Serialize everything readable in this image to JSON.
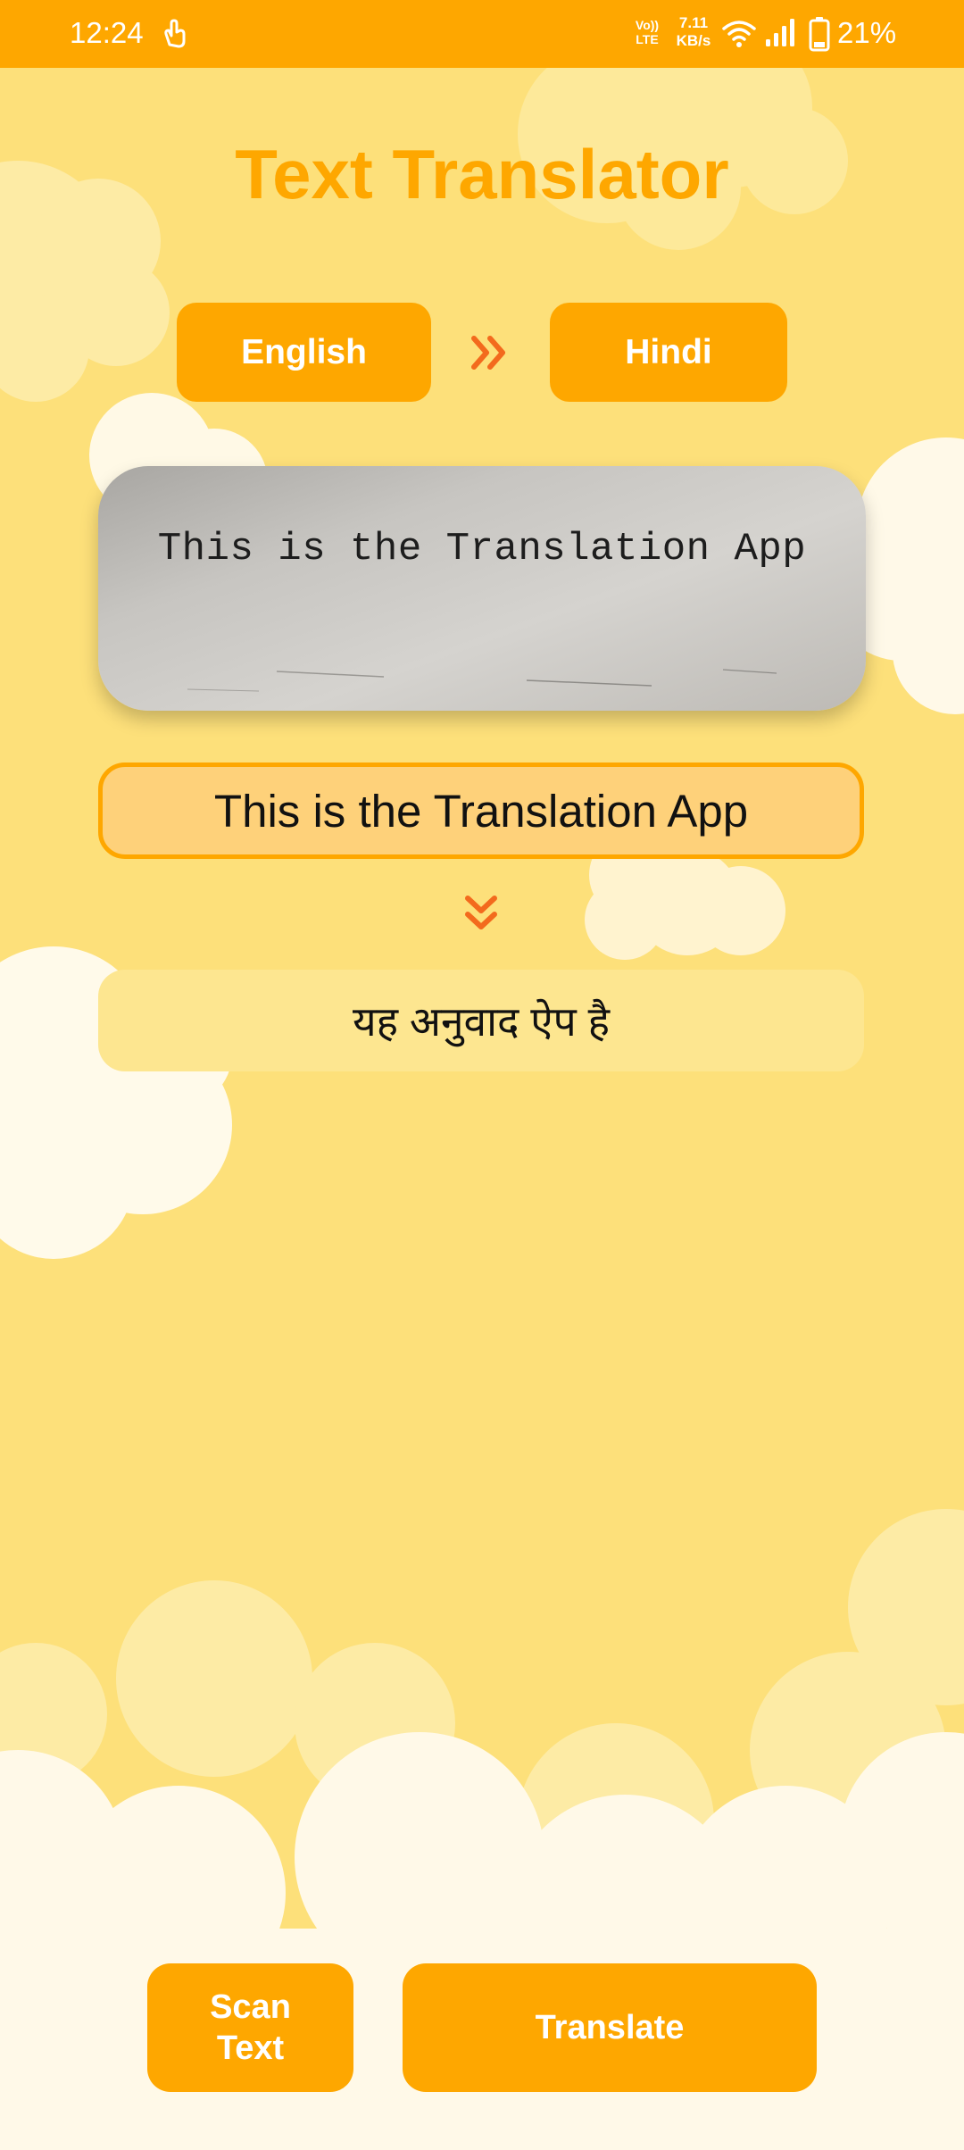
{
  "status_bar": {
    "time": "12:24",
    "volte": "Vo)) LTE",
    "net_speed_value": "7.11",
    "net_speed_unit": "KB/s",
    "battery_percent": "21%",
    "icons": [
      "gesture-icon",
      "volte-icon",
      "wifi-icon",
      "signal-icon",
      "battery-icon"
    ]
  },
  "app": {
    "title": "Text Translator",
    "source_language": "English",
    "target_language": "Hindi",
    "scanned_image_text": "This is the Translation App",
    "recognized_text": "This is the Translation App",
    "translated_text": "यह अनुवाद ऐप है",
    "scan_button": "Scan Text",
    "translate_button": "Translate"
  },
  "colors": {
    "accent": "#fea700",
    "background": "#fde07a",
    "arrow": "#f36a1d",
    "recognized_fill": "#fed17a",
    "translated_fill": "#fde690",
    "cloud": "#fff9e8"
  }
}
